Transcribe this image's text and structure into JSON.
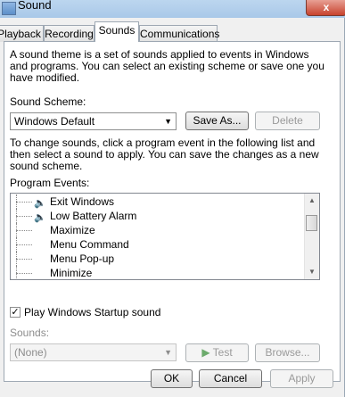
{
  "window": {
    "title": "Sound",
    "close_glyph": "x"
  },
  "tabs": [
    {
      "label": "Playback"
    },
    {
      "label": "Recording"
    },
    {
      "label": "Sounds"
    },
    {
      "label": "Communications"
    }
  ],
  "intro_text": [
    "A sound theme is a set of sounds applied to events in Windows",
    "and programs.  You can select an existing scheme or save one you",
    "have modified."
  ],
  "scheme": {
    "label": "Sound Scheme:",
    "selected": "Windows Default",
    "save_as": "Save As...",
    "delete": "Delete"
  },
  "change_text": [
    "To change sounds, click a program event in the following list and",
    "then select a sound to apply.  You can save the changes as a new",
    "sound scheme."
  ],
  "events": {
    "label": "Program Events:",
    "items": [
      {
        "label": "Exit Windows",
        "has_sound": true
      },
      {
        "label": "Low Battery Alarm",
        "has_sound": true
      },
      {
        "label": "Maximize",
        "has_sound": false
      },
      {
        "label": "Menu Command",
        "has_sound": false
      },
      {
        "label": "Menu Pop-up",
        "has_sound": false
      },
      {
        "label": "Minimize",
        "has_sound": false
      }
    ]
  },
  "startup": {
    "label": "Play Windows Startup sound",
    "checked": true,
    "check_glyph": "✓"
  },
  "sounds": {
    "label": "Sounds:",
    "selected": "(None)",
    "test": "Test",
    "browse": "Browse..."
  },
  "footer": {
    "ok": "OK",
    "cancel": "Cancel",
    "apply": "Apply"
  },
  "colors": {
    "accent": "#3c7fb1",
    "title_bar": "#bcd6ef",
    "close_red": "#c7432e"
  }
}
